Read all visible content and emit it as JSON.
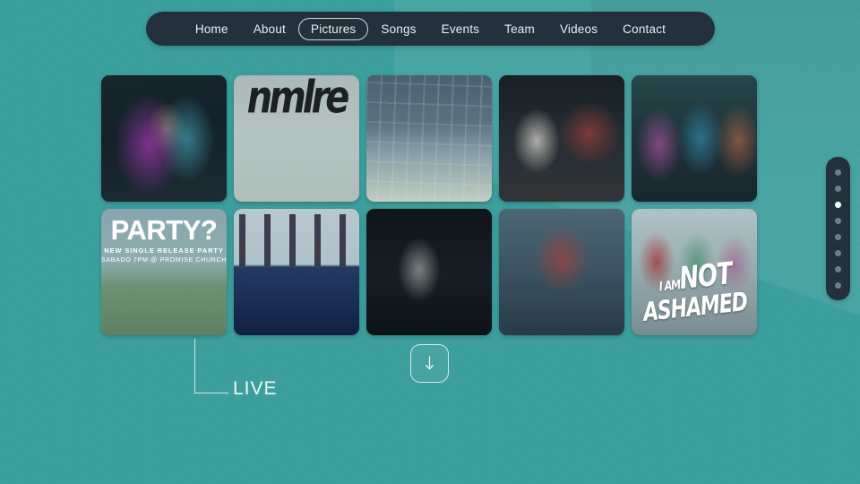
{
  "theme": {
    "background_color": "#3a9e9c",
    "panel_color": "#22313c",
    "accent_color": "#ffffff"
  },
  "nav": {
    "items": [
      {
        "label": "Home",
        "active": false
      },
      {
        "label": "About",
        "active": false
      },
      {
        "label": "Pictures",
        "active": true
      },
      {
        "label": "Songs",
        "active": false
      },
      {
        "label": "Events",
        "active": false
      },
      {
        "label": "Team",
        "active": false
      },
      {
        "label": "Videos",
        "active": false
      },
      {
        "label": "Contact",
        "active": false
      }
    ]
  },
  "gallery": {
    "tiles": [
      {
        "id": "tile-1",
        "alt": "two singers on dark stage with colorful light painting"
      },
      {
        "id": "tile-2",
        "alt": "three band members in front of white garage door with black graffiti",
        "graffiti": "nmlre"
      },
      {
        "id": "tile-3",
        "alt": "male vocalist singing into microphone under metal scaffolding"
      },
      {
        "id": "tile-4",
        "alt": "female singer with tambourine and guitarist on confetti stage"
      },
      {
        "id": "tile-5",
        "alt": "three musicians singing together in patterned jackets"
      },
      {
        "id": "tile-6",
        "alt": "party flyer poster over field photo",
        "title": "PARTY?",
        "subtitle": "NEW SINGLE RELEASE PARTY",
        "detail": "SABADO 7PM @ PROMISE CHURCH"
      },
      {
        "id": "tile-7",
        "alt": "concert stage with dancer projection screen and bassist"
      },
      {
        "id": "tile-8",
        "alt": "guitarist singing on dark stage with drum kit"
      },
      {
        "id": "tile-9",
        "alt": "acoustic band playing live with PAN backdrop"
      },
      {
        "id": "tile-10",
        "alt": "group photo with I AM NOT ASHAMED brush lettering",
        "overlay_line1": "I AM",
        "overlay_line2": "NOT",
        "overlay_line3": "ASHAMED"
      }
    ]
  },
  "annotation": {
    "live_label": "LIVE"
  },
  "scroll_button": {
    "icon": "arrow-down-icon",
    "label": "↓"
  },
  "dot_nav": {
    "total": 8,
    "active_index": 2,
    "dots": [
      {
        "index": 0
      },
      {
        "index": 1
      },
      {
        "index": 2
      },
      {
        "index": 3
      },
      {
        "index": 4
      },
      {
        "index": 5
      },
      {
        "index": 6
      },
      {
        "index": 7
      }
    ]
  }
}
